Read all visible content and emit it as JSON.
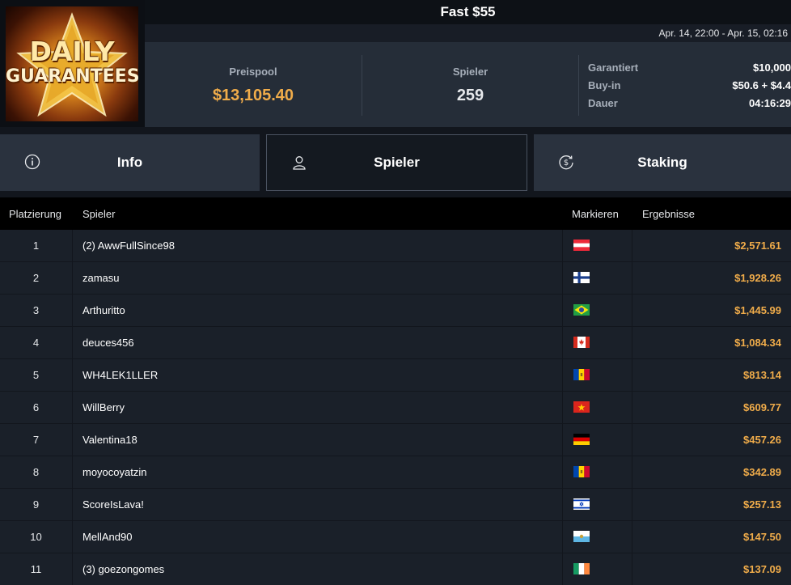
{
  "logo": {
    "line1": "DAILY",
    "line2": "GUARANTEES"
  },
  "title": "Fast $55",
  "date_range": "Apr. 14, 22:00 - Apr. 15, 02:16",
  "stats": {
    "prize_pool_label": "Preispool",
    "prize_pool_value": "$13,105.40",
    "players_label": "Spieler",
    "players_value": "259"
  },
  "details": [
    {
      "key": "Garantiert",
      "value": "$10,000"
    },
    {
      "key": "Buy-in",
      "value": "$50.6 + $4.4"
    },
    {
      "key": "Dauer",
      "value": "04:16:29"
    }
  ],
  "tabs": [
    {
      "label": "Info",
      "icon": "info-icon"
    },
    {
      "label": "Spieler",
      "icon": "user-icon",
      "active": true
    },
    {
      "label": "Staking",
      "icon": "dollar-cycle-icon"
    }
  ],
  "table": {
    "headers": {
      "rank": "Platzierung",
      "player": "Spieler",
      "flag": "Markieren",
      "result": "Ergebnisse"
    },
    "rows": [
      {
        "rank": "1",
        "player": "(2) AwwFullSince98",
        "flag": "austria",
        "result": "$2,571.61"
      },
      {
        "rank": "2",
        "player": "zamasu",
        "flag": "finland",
        "result": "$1,928.26"
      },
      {
        "rank": "3",
        "player": "Arthuritto",
        "flag": "brazil",
        "result": "$1,445.99"
      },
      {
        "rank": "4",
        "player": "deuces456",
        "flag": "canada",
        "result": "$1,084.34"
      },
      {
        "rank": "5",
        "player": "WH4LEK1LLER",
        "flag": "moldova",
        "result": "$813.14"
      },
      {
        "rank": "6",
        "player": "WillBerry",
        "flag": "vietnam",
        "result": "$609.77"
      },
      {
        "rank": "7",
        "player": "Valentina18",
        "flag": "germany",
        "result": "$457.26"
      },
      {
        "rank": "8",
        "player": "moyocoyatzin",
        "flag": "moldova",
        "result": "$342.89"
      },
      {
        "rank": "9",
        "player": "ScoreIsLava!",
        "flag": "israel",
        "result": "$257.13"
      },
      {
        "rank": "10",
        "player": "MellAnd90",
        "flag": "san-marino",
        "result": "$147.50"
      },
      {
        "rank": "11",
        "player": "(3) goezongomes",
        "flag": "ireland",
        "result": "$137.09"
      }
    ]
  },
  "colors": {
    "accent": "#f0ac4a",
    "panel": "#252d38",
    "row": "#1a2029"
  }
}
